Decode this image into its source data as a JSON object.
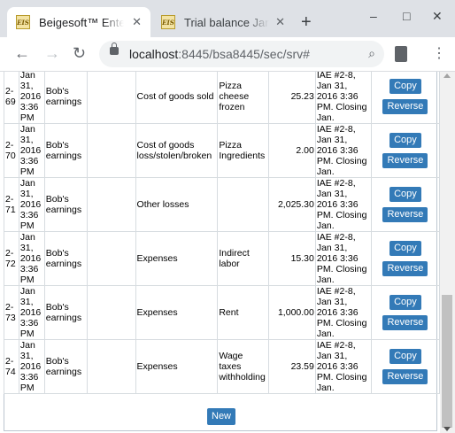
{
  "browser": {
    "tabs": [
      {
        "favicon": "EIS",
        "title": "Beigesoft™ Enterprise",
        "close": "✕"
      },
      {
        "favicon": "EIS",
        "title": "Trial balance Jan",
        "close": "✕"
      }
    ],
    "new_tab": "+",
    "controls": {
      "minimize": "–",
      "maximize": "□",
      "close": "✕"
    },
    "nav": {
      "back": "←",
      "forward": "→",
      "reload": "↻"
    },
    "url_host": "localhost",
    "url_rest": ":8445/bsa8445/sec/srv#",
    "menu": "⋮"
  },
  "table": {
    "rows": [
      {
        "id": "2-69",
        "date": "Jan 31, 2016 3:36 PM",
        "account": "Bob's earnings",
        "subacc": "",
        "category": "Cost of goods sold",
        "item": "Pizza cheese frozen",
        "amount": "25.23",
        "doc": "IAE #2-8, Jan 31, 2016 3:36 PM. Closing Jan.",
        "copy": "Copy",
        "reverse": "Reverse"
      },
      {
        "id": "2-70",
        "date": "Jan 31, 2016 3:36 PM",
        "account": "Bob's earnings",
        "subacc": "",
        "category": "Cost of goods loss/stolen/broken",
        "item": "Pizza Ingredients",
        "amount": "2.00",
        "doc": "IAE #2-8, Jan 31, 2016 3:36 PM. Closing Jan.",
        "copy": "Copy",
        "reverse": "Reverse"
      },
      {
        "id": "2-71",
        "date": "Jan 31, 2016 3:36 PM",
        "account": "Bob's earnings",
        "subacc": "",
        "category": "Other losses",
        "item": "",
        "amount": "2,025.30",
        "doc": "IAE #2-8, Jan 31, 2016 3:36 PM. Closing Jan.",
        "copy": "Copy",
        "reverse": "Reverse"
      },
      {
        "id": "2-72",
        "date": "Jan 31, 2016 3:36 PM",
        "account": "Bob's earnings",
        "subacc": "",
        "category": "Expenses",
        "item": "Indirect labor",
        "amount": "15.30",
        "doc": "IAE #2-8, Jan 31, 2016 3:36 PM. Closing Jan.",
        "copy": "Copy",
        "reverse": "Reverse"
      },
      {
        "id": "2-73",
        "date": "Jan 31, 2016 3:36 PM",
        "account": "Bob's earnings",
        "subacc": "",
        "category": "Expenses",
        "item": "Rent",
        "amount": "1,000.00",
        "doc": "IAE #2-8, Jan 31, 2016 3:36 PM. Closing Jan.",
        "copy": "Copy",
        "reverse": "Reverse"
      },
      {
        "id": "2-74",
        "date": "Jan 31, 2016 3:36 PM",
        "account": "Bob's earnings",
        "subacc": "",
        "category": "Expenses",
        "item": "Wage taxes withholding",
        "amount": "23.59",
        "doc": "IAE #2-8, Jan 31, 2016 3:36 PM. Closing Jan.",
        "copy": "Copy",
        "reverse": "Reverse"
      }
    ]
  },
  "new_button": "New",
  "colors": {
    "button": "#337ab7",
    "tabbar": "#dee1e6"
  }
}
